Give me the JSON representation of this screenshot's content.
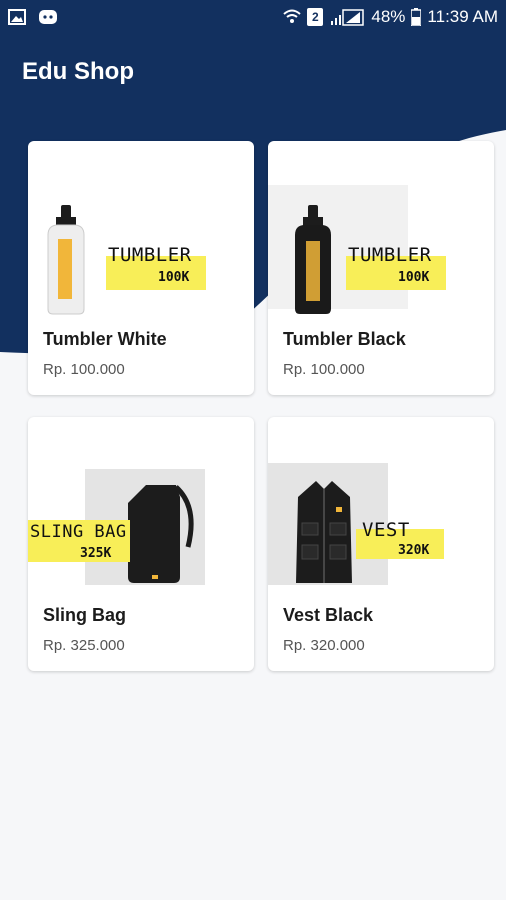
{
  "status_bar": {
    "battery": "48%",
    "time": "11:39 AM",
    "sim_slot": "2",
    "icons": [
      "image-icon",
      "notification-icon",
      "wifi-icon",
      "signal-icon",
      "battery-icon"
    ]
  },
  "app": {
    "title": "Edu Shop",
    "theme_color": "#12305f",
    "accent_color": "#f8ee58"
  },
  "products": [
    {
      "name": "Tumbler White",
      "price": "Rp. 100.000",
      "image_tag": "TUMBLER",
      "image_price": "100K",
      "image": "white-tumbler-icon"
    },
    {
      "name": "Tumbler Black",
      "price": "Rp. 100.000",
      "image_tag": "TUMBLER",
      "image_price": "100K",
      "image": "black-tumbler-icon"
    },
    {
      "name": "Sling Bag",
      "price": "Rp. 325.000",
      "image_tag": "SLING BAG",
      "image_price": "325K",
      "image": "sling-bag-icon"
    },
    {
      "name": "Vest Black",
      "price": "Rp. 320.000",
      "image_tag": "VEST",
      "image_price": "320K",
      "image": "vest-icon"
    }
  ]
}
